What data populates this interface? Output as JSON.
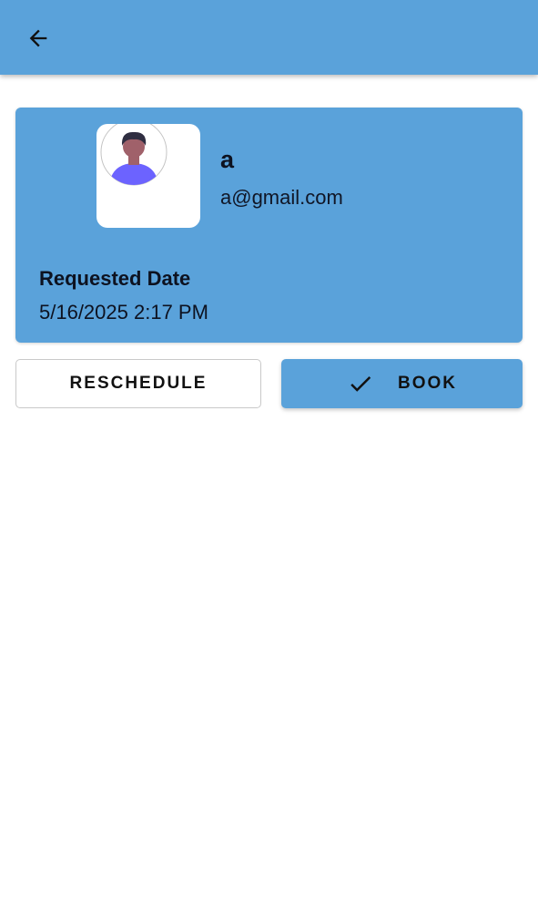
{
  "header": {
    "back_icon": "arrow-left-icon"
  },
  "client": {
    "avatar_icon": "user-avatar-icon",
    "name": "a",
    "email": "a@gmail.com"
  },
  "booking": {
    "requested_date_label": "Requested Date",
    "requested_date_value": "5/16/2025 2:17 PM"
  },
  "actions": {
    "reschedule_label": "RESCHEDULE",
    "book_label": "BOOK",
    "book_icon": "check-icon"
  },
  "colors": {
    "primary": "#5aa2da",
    "text": "#0d1220",
    "avatar_shirt": "#6c63ff",
    "avatar_skin": "#a0616a",
    "avatar_hair": "#2f2e41"
  }
}
